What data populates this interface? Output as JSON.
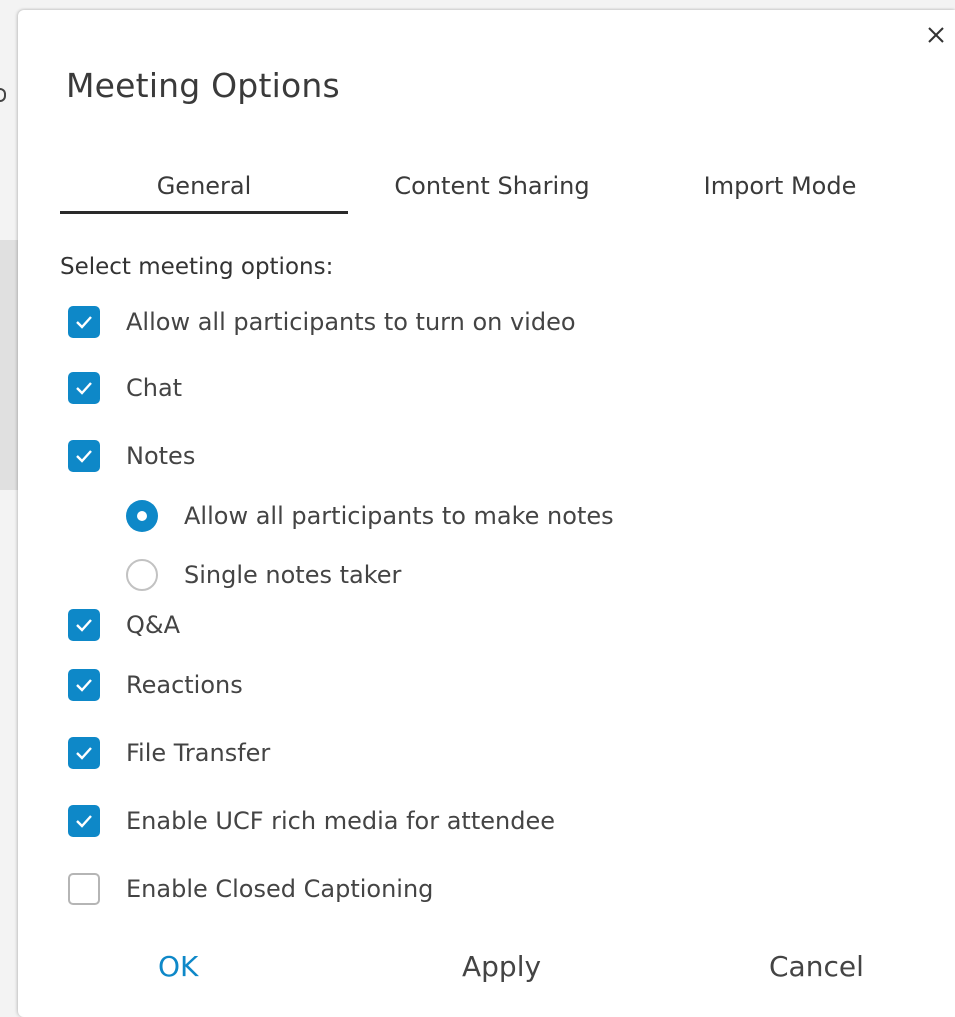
{
  "dialog": {
    "title": "Meeting Options",
    "close_label": "×"
  },
  "tabs": [
    {
      "label": "General",
      "active": true
    },
    {
      "label": "Content Sharing",
      "active": false
    },
    {
      "label": "Import Mode",
      "active": false
    }
  ],
  "general": {
    "section_label": "Select meeting options:",
    "options": [
      {
        "label": "Allow all participants to turn on video",
        "checked": true
      },
      {
        "label": "Chat",
        "checked": true
      },
      {
        "label": "Notes",
        "checked": true
      },
      {
        "label": "Q&A",
        "checked": true
      },
      {
        "label": "Reactions",
        "checked": true
      },
      {
        "label": "File Transfer",
        "checked": true
      },
      {
        "label": "Enable UCF rich media for attendee",
        "checked": true
      },
      {
        "label": "Enable Closed Captioning",
        "checked": false
      }
    ],
    "notes_radios": [
      {
        "label": "Allow all participants to make notes",
        "selected": true
      },
      {
        "label": "Single notes taker",
        "selected": false
      }
    ]
  },
  "footer": {
    "ok": "OK",
    "apply": "Apply",
    "cancel": "Cancel"
  },
  "colors": {
    "accent": "#0e88c8",
    "checkbox_border": "#b5b5b5"
  }
}
